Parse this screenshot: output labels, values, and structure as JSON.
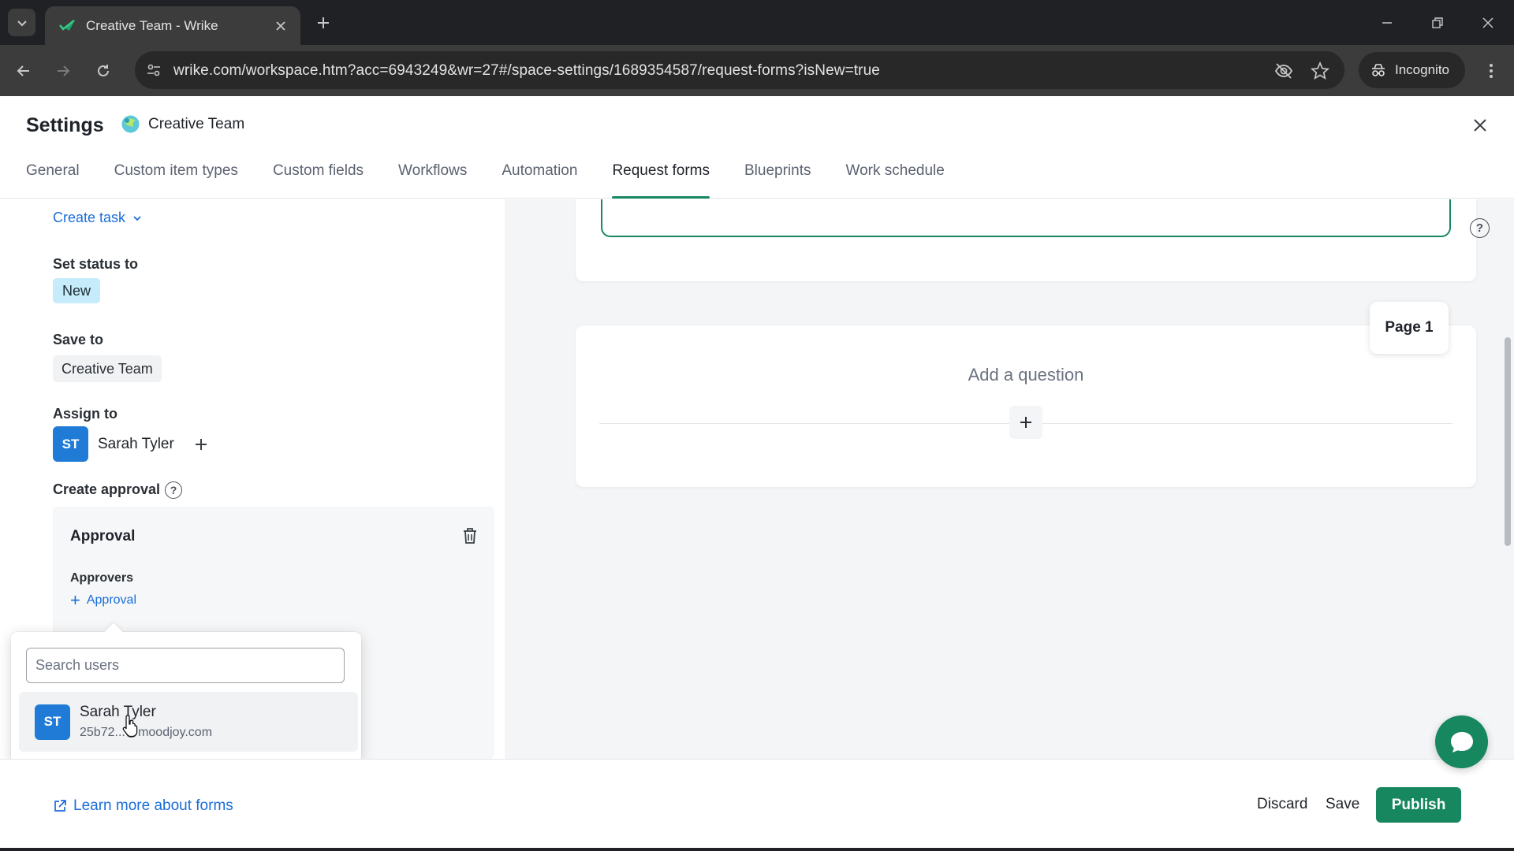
{
  "browser": {
    "tab_title": "Creative Team - Wrike",
    "url": "wrike.com/workspace.htm?acc=6943249&wr=27#/space-settings/1689354587/request-forms?isNew=true",
    "incognito_label": "Incognito"
  },
  "header": {
    "title": "Settings",
    "space_name": "Creative Team",
    "tabs": [
      {
        "label": "General"
      },
      {
        "label": "Custom item types"
      },
      {
        "label": "Custom fields"
      },
      {
        "label": "Workflows"
      },
      {
        "label": "Automation"
      },
      {
        "label": "Request forms",
        "active": true
      },
      {
        "label": "Blueprints"
      },
      {
        "label": "Work schedule"
      }
    ]
  },
  "left": {
    "create_task": "Create task",
    "set_status_label": "Set status to",
    "status_value": "New",
    "save_to_label": "Save to",
    "save_to_value": "Creative Team",
    "assign_to_label": "Assign to",
    "assignee": {
      "initials": "ST",
      "name": "Sarah Tyler"
    },
    "create_approval_label": "Create approval",
    "help_glyph": "?",
    "approval": {
      "title": "Approval",
      "approvers_label": "Approvers",
      "add_approval": "Approval"
    }
  },
  "dropdown": {
    "search_placeholder": "Search users",
    "users": [
      {
        "initials": "ST",
        "name": "Sarah Tyler",
        "email": "25b72...@moodjoy.com"
      }
    ]
  },
  "canvas": {
    "page_tag": "Page 1",
    "add_question": "Add a question",
    "help_glyph": "?"
  },
  "footer": {
    "learn_more": "Learn more about forms",
    "discard": "Discard",
    "save": "Save",
    "publish": "Publish"
  },
  "colors": {
    "accent_green": "#17875f",
    "link_blue": "#1a6dd8",
    "avatar_blue": "#1f7bd6",
    "status_new_bg": "#c6ecfb"
  },
  "icons": [
    "tab-search-icon",
    "wrike-check-icon",
    "close-icon",
    "plus-icon",
    "back-arrow-icon",
    "forward-arrow-icon",
    "reload-icon",
    "site-info-icon",
    "eye-off-icon",
    "star-icon",
    "incognito-icon",
    "kebab-menu-icon",
    "chevron-down-icon",
    "trash-icon",
    "external-link-icon",
    "chat-icon"
  ]
}
